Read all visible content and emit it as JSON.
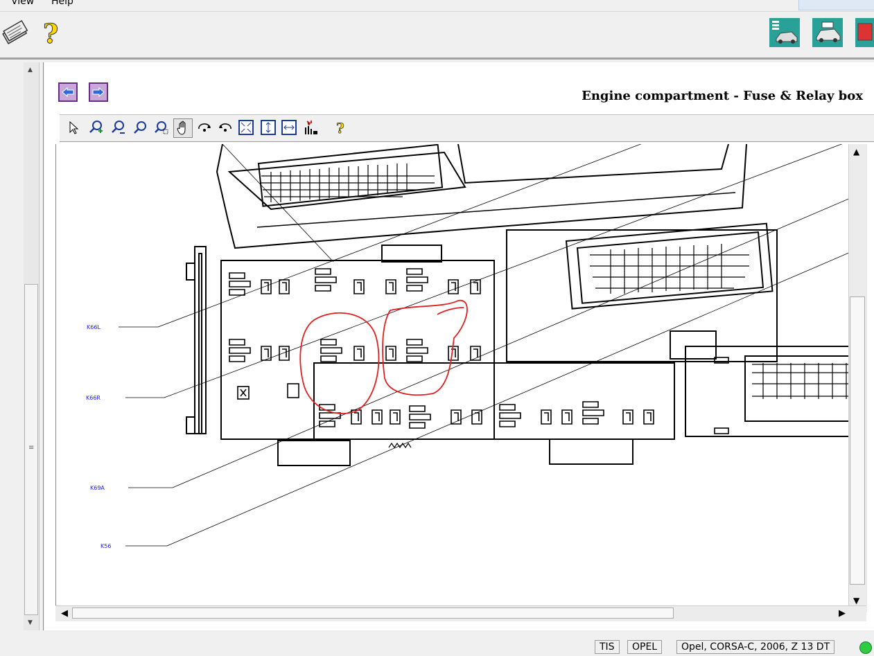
{
  "menu": {
    "items": [
      {
        "label": "View"
      },
      {
        "label": "Help"
      }
    ]
  },
  "toolbar": {
    "left_icons": [
      "document-stack-icon",
      "question-mark-icon"
    ],
    "right_icons": [
      "vehicle-list-icon",
      "vehicle-service-icon",
      "vehicle-red-icon"
    ]
  },
  "content": {
    "title": "Engine compartment - Fuse & Relay box",
    "nav": {
      "back_icon": "arrow-left-icon",
      "forward_icon": "arrow-right-icon"
    },
    "viewer_tools": [
      "pointer-icon",
      "zoom-in-icon",
      "zoom-out-icon",
      "zoom-icon",
      "zoom-window-icon",
      "pan-hand-icon",
      "rotate-cw-icon",
      "rotate-ccw-icon",
      "fit-window-icon",
      "fit-height-icon",
      "fit-width-icon",
      "hotspot-icon",
      "help-icon"
    ],
    "diagram": {
      "labels": [
        "K66L",
        "K66R",
        "K69A",
        "K56"
      ]
    }
  },
  "status": {
    "cells": [
      "TIS",
      "OPEL",
      "Opel, CORSA-C, 2006, Z 13 DT"
    ],
    "indicator_color": "#2ecc40"
  }
}
